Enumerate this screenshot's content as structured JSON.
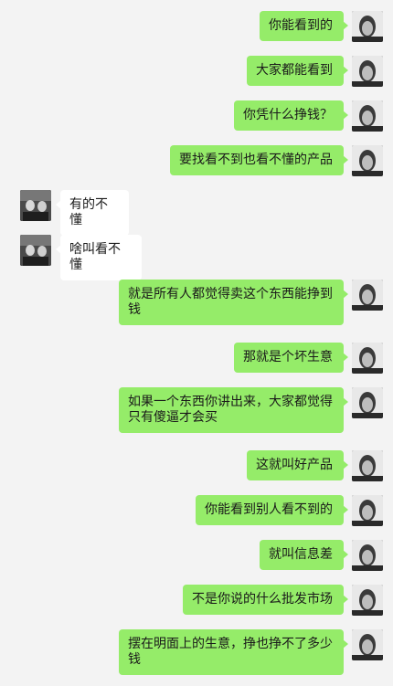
{
  "messages": [
    {
      "sender": "me",
      "text": "你能看到的"
    },
    {
      "sender": "me",
      "text": "大家都能看到"
    },
    {
      "sender": "me",
      "text": "你凭什么挣钱？"
    },
    {
      "sender": "me",
      "text": "要找看不到也看不懂的产品"
    },
    {
      "sender": "other",
      "text": "有的不懂"
    },
    {
      "sender": "other",
      "text": "啥叫看不懂"
    },
    {
      "sender": "me",
      "text": "就是所有人都觉得卖这个东西能挣到钱"
    },
    {
      "sender": "me",
      "text": "那就是个坏生意"
    },
    {
      "sender": "me",
      "text": "如果一个东西你讲出来，大家都觉得只有傻逼才会买"
    },
    {
      "sender": "me",
      "text": "这就叫好产品"
    },
    {
      "sender": "me",
      "text": "你能看到别人看不到的"
    },
    {
      "sender": "me",
      "text": "就叫信息差"
    },
    {
      "sender": "me",
      "text": "不是你说的什么批发市场"
    },
    {
      "sender": "me",
      "text": "摆在明面上的生意，挣也挣不了多少钱"
    }
  ]
}
